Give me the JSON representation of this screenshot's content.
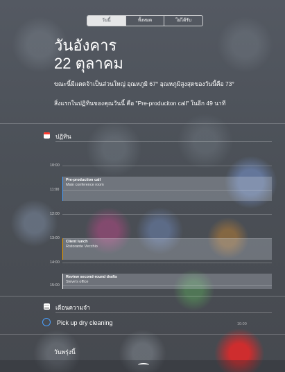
{
  "tabs": [
    {
      "label": "วันนี้",
      "active": true
    },
    {
      "label": "ทั้งหมด",
      "active": false
    },
    {
      "label": "ไม่ได้รับ",
      "active": false
    }
  ],
  "today": {
    "day_name": "วันอังคาร",
    "date": "22 ตุลาคม",
    "weather": "ขณะนี้มีแดดจ้าเป็นส่วนใหญ่ อุณหภูมิ 67°  อุณหภูมิสูงสุดของวันนี้คือ 73°",
    "first_event": "สิ่งแรกในปฏิทินของคุณวันนี้ คือ \"Pre-produciton call\" ในอีก 49 นาที"
  },
  "calendar": {
    "title": "ปฏิทิน",
    "icon": "calendar-icon",
    "hours": [
      "10:00",
      "11:00",
      "12:00",
      "13:00",
      "14:00",
      "15:00"
    ],
    "events": [
      {
        "title": "Pre-production call",
        "location": "Main conference room",
        "color": "#4aa0ff"
      },
      {
        "title": "Client lunch",
        "location": "Ristorante Vecchio",
        "color": "#f0a000"
      },
      {
        "title": "Review second-round drafts",
        "location": "Steve's office",
        "color": "#ffffff"
      }
    ]
  },
  "reminders": {
    "title": "เตือนความจำ",
    "icon": "reminders-icon",
    "items": [
      {
        "text": "Pick up dry cleaning",
        "time": "10:00"
      }
    ]
  },
  "tomorrow": {
    "title": "วันพรุ่งนี้"
  },
  "grabber_icon": "chevron-up-icon"
}
